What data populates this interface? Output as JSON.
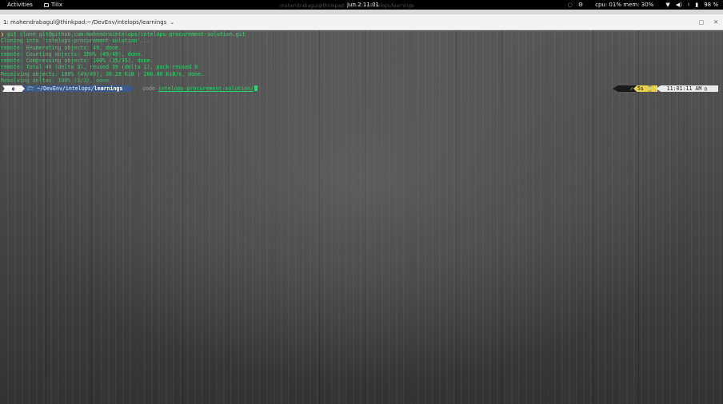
{
  "topbar": {
    "activities": "Activities",
    "app_name": "Tilix",
    "clock": "Jun 2  11:01",
    "system_stats": "cpu: 01% mem: 30%",
    "battery": "98 %",
    "icons": [
      "clipboard-icon",
      "settings-icon",
      "wifi-icon",
      "volume-icon",
      "mic-icon",
      "battery-icon"
    ]
  },
  "ghost_window": {
    "title": "mahendrabagul@thinkpad:~/DevEnv/intelops/learnings"
  },
  "titlebar": {
    "session_title": "1: mahendrabagul@thinkpad:~/DevEnv/intelops/learnings",
    "maximize": "□",
    "close": "✕"
  },
  "terminal": {
    "command_prompt": "❯",
    "command": "git clone git@github.com:mahendraintelops/intelops-procurement-solution.git",
    "output": [
      "Cloning into 'intelops-procurement-solution'...",
      "remote: Enumerating objects: 49, done.",
      "remote: Counting objects: 100% (49/49), done.",
      "remote: Compressing objects: 100% (35/35), done.",
      "remote: Total 49 (delta 3), reused 39 (delta 1), pack-reused 0",
      "Receiving objects: 100% (49/49), 36.28 KiB | 206.00 KiB/s, done.",
      "Resolving deltas: 100% (3/3), done."
    ],
    "prompt": {
      "dir_prefix": "~/DevEnv/intelops/",
      "dir_current": "learnings",
      "typed_cmd": "code",
      "typed_arg": "intelops-procurement-solution/",
      "status": "✓",
      "duration": "5s ⌛",
      "time": "11:01:11 AM"
    }
  },
  "colors": {
    "terminal_text": "#2bd36a",
    "dir_segment": "#3c5a8a",
    "duration_segment": "#e8d24a"
  }
}
